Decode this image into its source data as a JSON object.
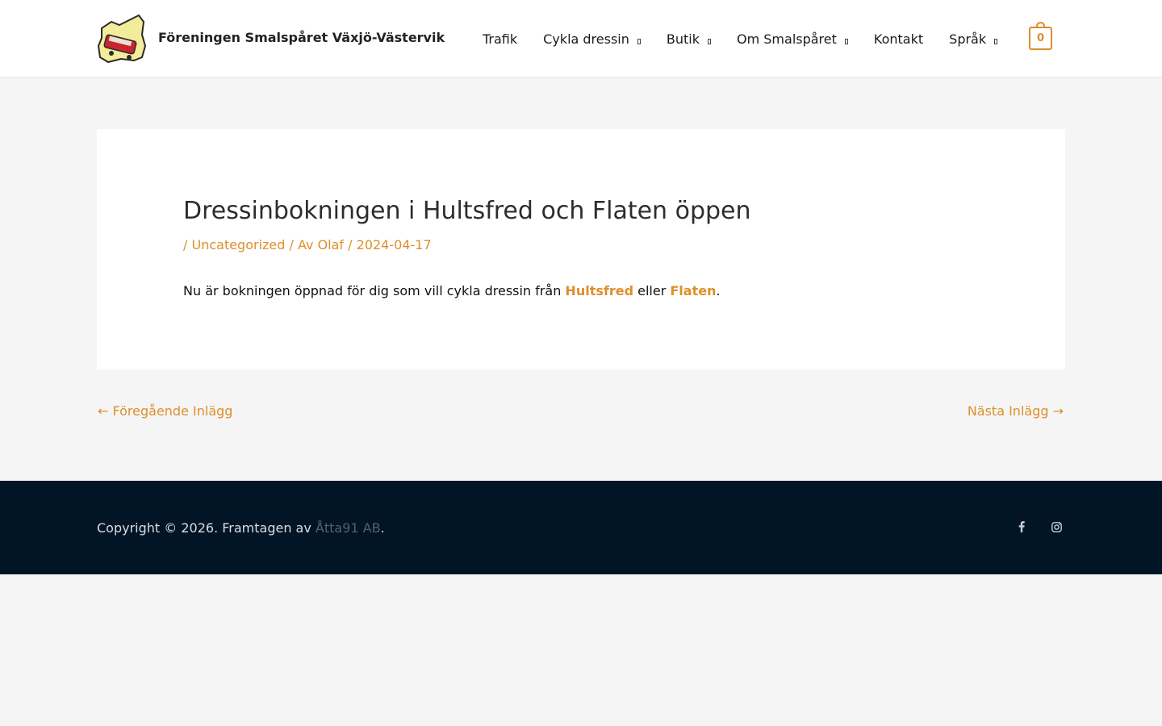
{
  "site": {
    "title": "Föreningen Smalspåret Växjö-Västervik"
  },
  "nav": {
    "items": [
      {
        "label": "Trafik",
        "has_dropdown": false
      },
      {
        "label": "Cykla dressin",
        "has_dropdown": true
      },
      {
        "label": "Butik",
        "has_dropdown": true
      },
      {
        "label": "Om Smalspåret",
        "has_dropdown": true
      },
      {
        "label": "Kontakt",
        "has_dropdown": false
      },
      {
        "label": "Språk",
        "has_dropdown": true
      }
    ],
    "cart_count": "0"
  },
  "post": {
    "title": "Dressinbokningen i Hultsfred och Flaten öppen",
    "meta_sep": "/",
    "category": "Uncategorized",
    "author_prefix": "Av",
    "author": "Olaf",
    "date": "2024-04-17",
    "content_text": "Nu är bokningen öppnad för dig som vill cykla dressin från",
    "link_hultsfred": "Hultsfred",
    "content_mid": "eller",
    "link_flaten": "Flaten",
    "content_end": "."
  },
  "post_nav": {
    "prev": "← Föregående Inlägg",
    "next": "Nästa Inlägg →"
  },
  "footer": {
    "copyright": "Copyright © 2026. Framtagen av",
    "company": "Åtta91 AB",
    "end": ".",
    "social": [
      "facebook-icon",
      "instagram-icon"
    ]
  },
  "colors": {
    "accent": "#dd8f2a",
    "footer_bg": "#021526",
    "page_bg": "#f5f5f5"
  }
}
